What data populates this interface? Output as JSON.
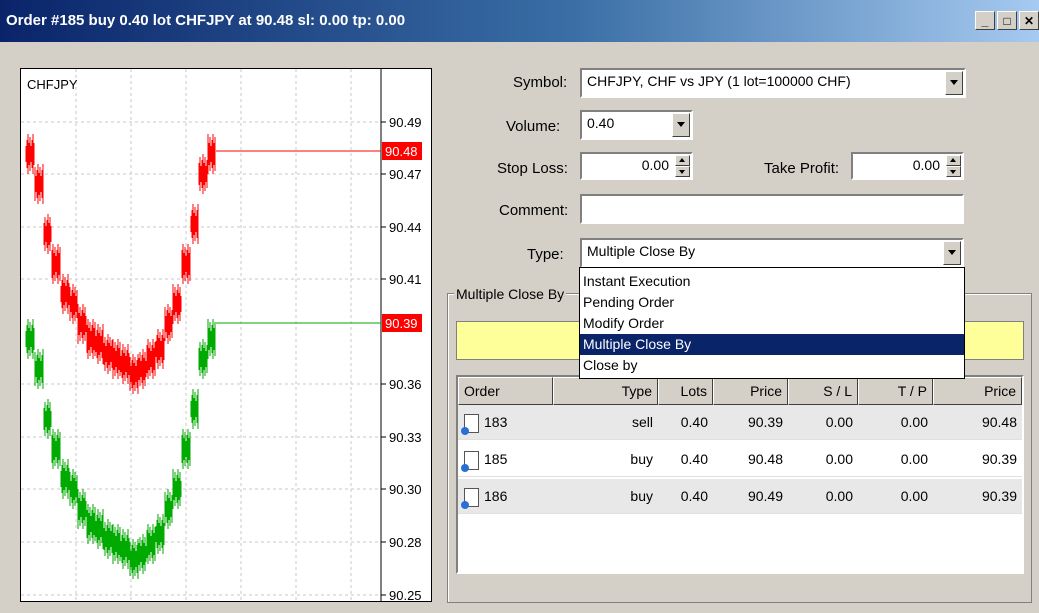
{
  "window": {
    "title": "Order #185 buy 0.40 lot CHFJPY at 90.48 sl: 0.00 tp: 0.00",
    "buttons": [
      "_",
      "□",
      "✕"
    ]
  },
  "chart": {
    "symbol": "CHFJPY",
    "price_labels": [
      "90.49",
      "90.47",
      "90.44",
      "90.41",
      "90.36",
      "90.33",
      "90.30",
      "90.28",
      "90.25"
    ],
    "ask_label": "90.48",
    "bid_label": "90.39",
    "ask_color": "#ff0000",
    "bid_color": "#00aa00"
  },
  "form": {
    "symbol_label": "Symbol:",
    "symbol_value": "CHFJPY, CHF vs JPY (1 lot=100000 CHF)",
    "volume_label": "Volume:",
    "volume_value": "0.40",
    "stoploss_label": "Stop Loss:",
    "stoploss_value": "0.00",
    "takeprofit_label": "Take Profit:",
    "takeprofit_value": "0.00",
    "comment_label": "Comment:",
    "comment_value": "",
    "type_label": "Type:",
    "type_value": "Multiple Close By"
  },
  "dropdown": {
    "options": [
      "Instant Execution",
      "Pending Order",
      "Modify Order",
      "Multiple Close By",
      "Close by"
    ],
    "selected_index": 3
  },
  "group": {
    "title": "Multiple Close By",
    "table": {
      "headers": [
        "Order",
        "Type",
        "Lots",
        "Price",
        "S / L",
        "T / P",
        "Price"
      ],
      "rows": [
        [
          "183",
          "sell",
          "0.40",
          "90.39",
          "0.00",
          "0.00",
          "90.48"
        ],
        [
          "185",
          "buy",
          "0.40",
          "90.48",
          "0.00",
          "0.00",
          "90.39"
        ],
        [
          "186",
          "buy",
          "0.40",
          "90.49",
          "0.00",
          "0.00",
          "90.39"
        ]
      ]
    }
  }
}
